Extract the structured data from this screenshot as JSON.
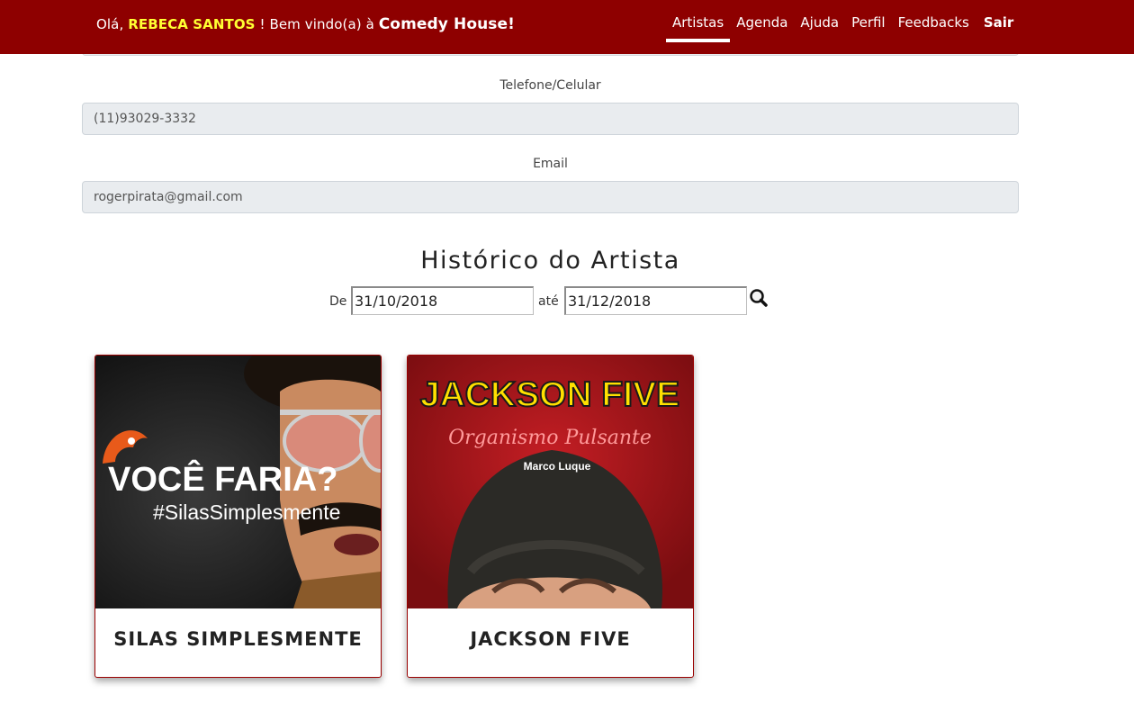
{
  "navbar": {
    "greeting_prefix": "Olá,",
    "user_name": "REBECA SANTOS",
    "greeting_middle": "! Bem vindo(a) à",
    "brand": "Comedy House!",
    "links": [
      {
        "label": "Artistas",
        "active": true
      },
      {
        "label": "Agenda",
        "active": false
      },
      {
        "label": "Ajuda",
        "active": false
      },
      {
        "label": "Perfil",
        "active": false
      },
      {
        "label": "Feedbacks",
        "active": false
      },
      {
        "label": "Sair",
        "active": false
      }
    ]
  },
  "form": {
    "phone_label": "Telefone/Celular",
    "phone_value": "(11)93029-3332",
    "email_label": "Email",
    "email_value": "rogerpirata@gmail.com"
  },
  "history": {
    "title": "Histórico do Artista",
    "from_label": "De",
    "from_value": "31/10/2018",
    "to_label": "até",
    "to_value": "31/12/2018",
    "search_icon": "magnifier-icon"
  },
  "cards": [
    {
      "name": "SILAS SIMPLESMENTE",
      "poster": {
        "headline": "VOCÊ FARIA?",
        "hashtag": "#SilasSimplesmente"
      }
    },
    {
      "name": "JACKSON FIVE",
      "poster": {
        "headline": "JACKSON FIVE",
        "subtitle": "Organismo Pulsante",
        "credit": "Marco Luque"
      }
    }
  ],
  "colors": {
    "navbar": "#8e0000",
    "user_highlight": "#ffff33",
    "card_border": "#9a0000",
    "input_bg": "#e9ecef"
  }
}
